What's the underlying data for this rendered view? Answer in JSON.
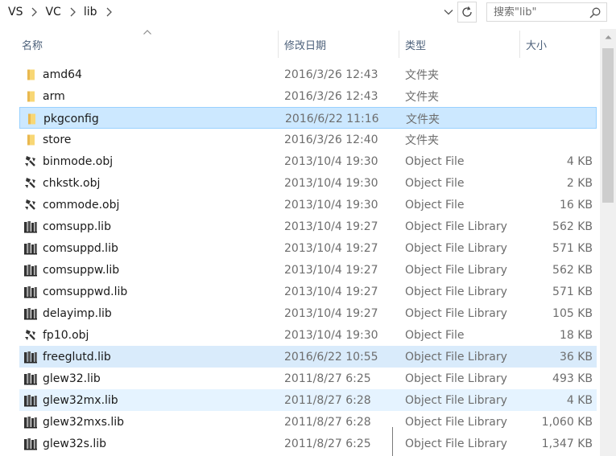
{
  "breadcrumb": [
    "VS",
    "VC",
    "lib"
  ],
  "search": {
    "placeholder": "搜索\"lib\""
  },
  "columns": {
    "name": "名称",
    "date": "修改日期",
    "type": "类型",
    "size": "大小"
  },
  "files": [
    {
      "icon": "folder-icon",
      "name": "amd64",
      "date": "2016/3/26 12:43",
      "type": "文件夹",
      "size": ""
    },
    {
      "icon": "folder-icon",
      "name": "arm",
      "date": "2016/3/26 12:43",
      "type": "文件夹",
      "size": ""
    },
    {
      "icon": "folder-icon",
      "name": "pkgconfig",
      "date": "2016/6/22 11:16",
      "type": "文件夹",
      "size": "",
      "state": "selected"
    },
    {
      "icon": "folder-icon",
      "name": "store",
      "date": "2016/3/26 12:40",
      "type": "文件夹",
      "size": ""
    },
    {
      "icon": "object-file-icon",
      "name": "binmode.obj",
      "date": "2013/10/4 19:30",
      "type": "Object File",
      "size": "4 KB"
    },
    {
      "icon": "object-file-icon",
      "name": "chkstk.obj",
      "date": "2013/10/4 19:30",
      "type": "Object File",
      "size": "2 KB"
    },
    {
      "icon": "object-file-icon",
      "name": "commode.obj",
      "date": "2013/10/4 19:30",
      "type": "Object File",
      "size": "16 KB"
    },
    {
      "icon": "library-icon",
      "name": "comsupp.lib",
      "date": "2013/10/4 19:27",
      "type": "Object File Library",
      "size": "562 KB"
    },
    {
      "icon": "library-icon",
      "name": "comsuppd.lib",
      "date": "2013/10/4 19:27",
      "type": "Object File Library",
      "size": "571 KB"
    },
    {
      "icon": "library-icon",
      "name": "comsuppw.lib",
      "date": "2013/10/4 19:27",
      "type": "Object File Library",
      "size": "562 KB"
    },
    {
      "icon": "library-icon",
      "name": "comsuppwd.lib",
      "date": "2013/10/4 19:27",
      "type": "Object File Library",
      "size": "571 KB"
    },
    {
      "icon": "library-icon",
      "name": "delayimp.lib",
      "date": "2013/10/4 19:27",
      "type": "Object File Library",
      "size": "105 KB"
    },
    {
      "icon": "object-file-icon",
      "name": "fp10.obj",
      "date": "2013/10/4 19:30",
      "type": "Object File",
      "size": "18 KB"
    },
    {
      "icon": "library-icon",
      "name": "freeglutd.lib",
      "date": "2016/6/22 10:55",
      "type": "Object File Library",
      "size": "36 KB",
      "state": "selected-soft"
    },
    {
      "icon": "library-icon",
      "name": "glew32.lib",
      "date": "2011/8/27 6:25",
      "type": "Object File Library",
      "size": "493 KB"
    },
    {
      "icon": "library-icon",
      "name": "glew32mx.lib",
      "date": "2011/8/27 6:28",
      "type": "Object File Library",
      "size": "4 KB",
      "state": "hover"
    },
    {
      "icon": "library-icon",
      "name": "glew32mxs.lib",
      "date": "2011/8/27 6:28",
      "type": "Object File Library",
      "size": "1,060 KB"
    },
    {
      "icon": "library-icon",
      "name": "glew32s.lib",
      "date": "2011/8/27 6:25",
      "type": "Object File Library",
      "size": "1,347 KB"
    }
  ],
  "colors": {
    "selected_bg": "#cce8ff",
    "selected_border": "#99d1ff",
    "hover_bg": "#e5f3ff",
    "folder": "#f8d775",
    "header_text": "#4c607a"
  }
}
